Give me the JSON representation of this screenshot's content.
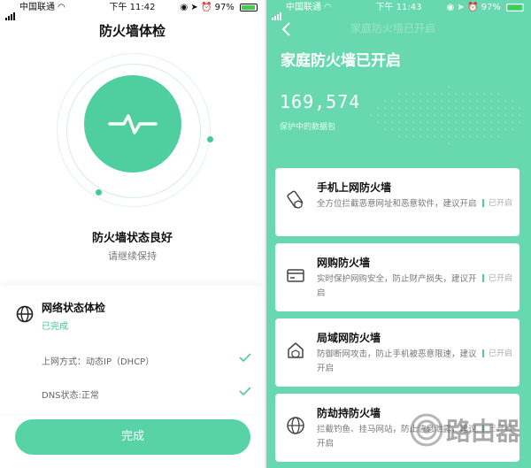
{
  "left": {
    "status": {
      "carrier": "中国联通",
      "time": "下午 11:42",
      "battery": "97%"
    },
    "title": "防火墙体检",
    "state_title": "防火墙状态良好",
    "state_sub": "请继续保持",
    "check_card": {
      "title": "网络状态体检",
      "status": "已完成",
      "rows": [
        {
          "label": "上网方式：动态IP（DHCP）"
        },
        {
          "label": "DNS状态:正常"
        }
      ]
    },
    "done_button": "完成",
    "colors": {
      "accent": "#4fcf9f",
      "button": "#58d3a8"
    }
  },
  "right": {
    "status": {
      "carrier": "中国联通",
      "time": "下午 11:43",
      "battery": "97%"
    },
    "ghost_title": "家庭防火墙已开启",
    "title": "家庭防火墙已开启",
    "count": "169,574",
    "count_label": "保护中的数据包",
    "cards": [
      {
        "name": "手机上网防火墙",
        "desc": "全方位拦截恶意网址和恶意软件，建议开启",
        "state": "已开启",
        "icon": "phone-shield-icon"
      },
      {
        "name": "网购防火墙",
        "desc": "实时保护网购安全，防止财产损失，建议开启",
        "state": "已开启",
        "icon": "card-icon"
      },
      {
        "name": "局域网防火墙",
        "desc": "防御断网攻击，防止手机被恶意限速，建议开启",
        "state": "已开启",
        "icon": "lan-house-icon"
      },
      {
        "name": "防劫持防火墙",
        "desc": "拦截钓鱼、挂马网站，防止信息泄露，建议开启",
        "state": "已开启",
        "icon": "globe-icon"
      }
    ],
    "watermark": "路由器",
    "colors": {
      "background": "#68d8b0"
    }
  }
}
